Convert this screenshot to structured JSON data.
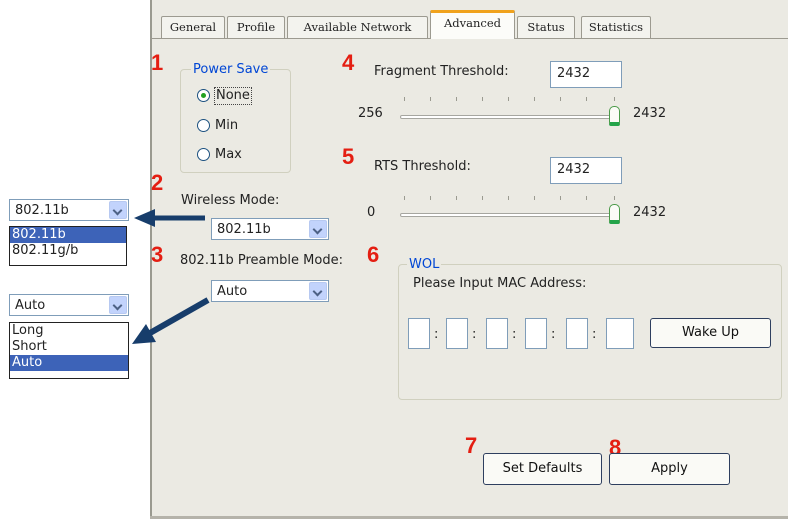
{
  "tabs": [
    "General",
    "Profile",
    "Available Network",
    "Advanced",
    "Status",
    "Statistics"
  ],
  "active_tab": "Advanced",
  "callouts": [
    "1",
    "2",
    "3",
    "4",
    "5",
    "6",
    "7",
    "8"
  ],
  "power_save": {
    "legend": "Power Save",
    "options": [
      "None",
      "Min",
      "Max"
    ],
    "selected": "None"
  },
  "wireless_mode": {
    "label": "Wireless Mode:",
    "value": "802.11b",
    "dropdown_options": [
      "802.11b",
      "802.11g/b"
    ],
    "dropdown_selected": "802.11b"
  },
  "preamble_mode": {
    "label": "802.11b Preamble Mode:",
    "value": "Auto",
    "dropdown_options": [
      "Long",
      "Short",
      "Auto"
    ],
    "dropdown_selected": "Auto"
  },
  "fragment_threshold": {
    "label": "Fragment Threshold:",
    "value": "2432",
    "slider_min": "256",
    "slider_max": "2432",
    "slider_level": 1.0
  },
  "rts_threshold": {
    "label": "RTS Threshold:",
    "value": "2432",
    "slider_min": "0",
    "slider_max": "2432",
    "slider_level": 1.0
  },
  "wol": {
    "legend": "WOL",
    "prompt": "Please Input MAC Address:",
    "separator": ":",
    "wake_button": "Wake Up"
  },
  "buttons": {
    "set_defaults": "Set Defaults",
    "apply": "Apply"
  },
  "colors": {
    "panel_bg": "#ebeae3",
    "legend_blue": "#0046d5",
    "callout_red": "#e41e12",
    "arrow_navy": "#173d6b",
    "tab_highlight": "#f0a21d",
    "selection_blue": "#3d63b8"
  }
}
